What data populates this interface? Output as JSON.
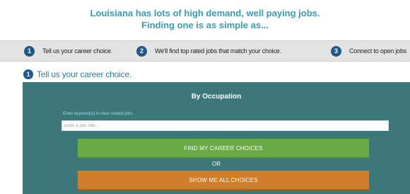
{
  "header": {
    "line1": "Louisiana has lots of high demand, well paying jobs.",
    "line2": "Finding one is as simple as..."
  },
  "steps": [
    {
      "number": "1",
      "label": "Tell us your career choice."
    },
    {
      "number": "2",
      "label": "We'll find top rated jobs that match your choice."
    },
    {
      "number": "3",
      "label": "Connect to open jobs"
    }
  ],
  "section": {
    "number": "1",
    "title": "Tell us your career choice."
  },
  "panel": {
    "title": "By Occupation",
    "hint": "Enter keyword(s) to view related jobs.",
    "input_placeholder": "Enter a Job Title...",
    "input_value": "",
    "primary_button": "FIND MY CAREER CHOICES",
    "or_label": "OR",
    "secondary_button": "SHOW ME ALL CHOICES"
  },
  "colors": {
    "accent": "#3b9bb0",
    "step_badge": "#1f5a8c",
    "panel_bg": "#3d7779",
    "primary_button": "#6aaa45",
    "secondary_button": "#d07d2c"
  }
}
